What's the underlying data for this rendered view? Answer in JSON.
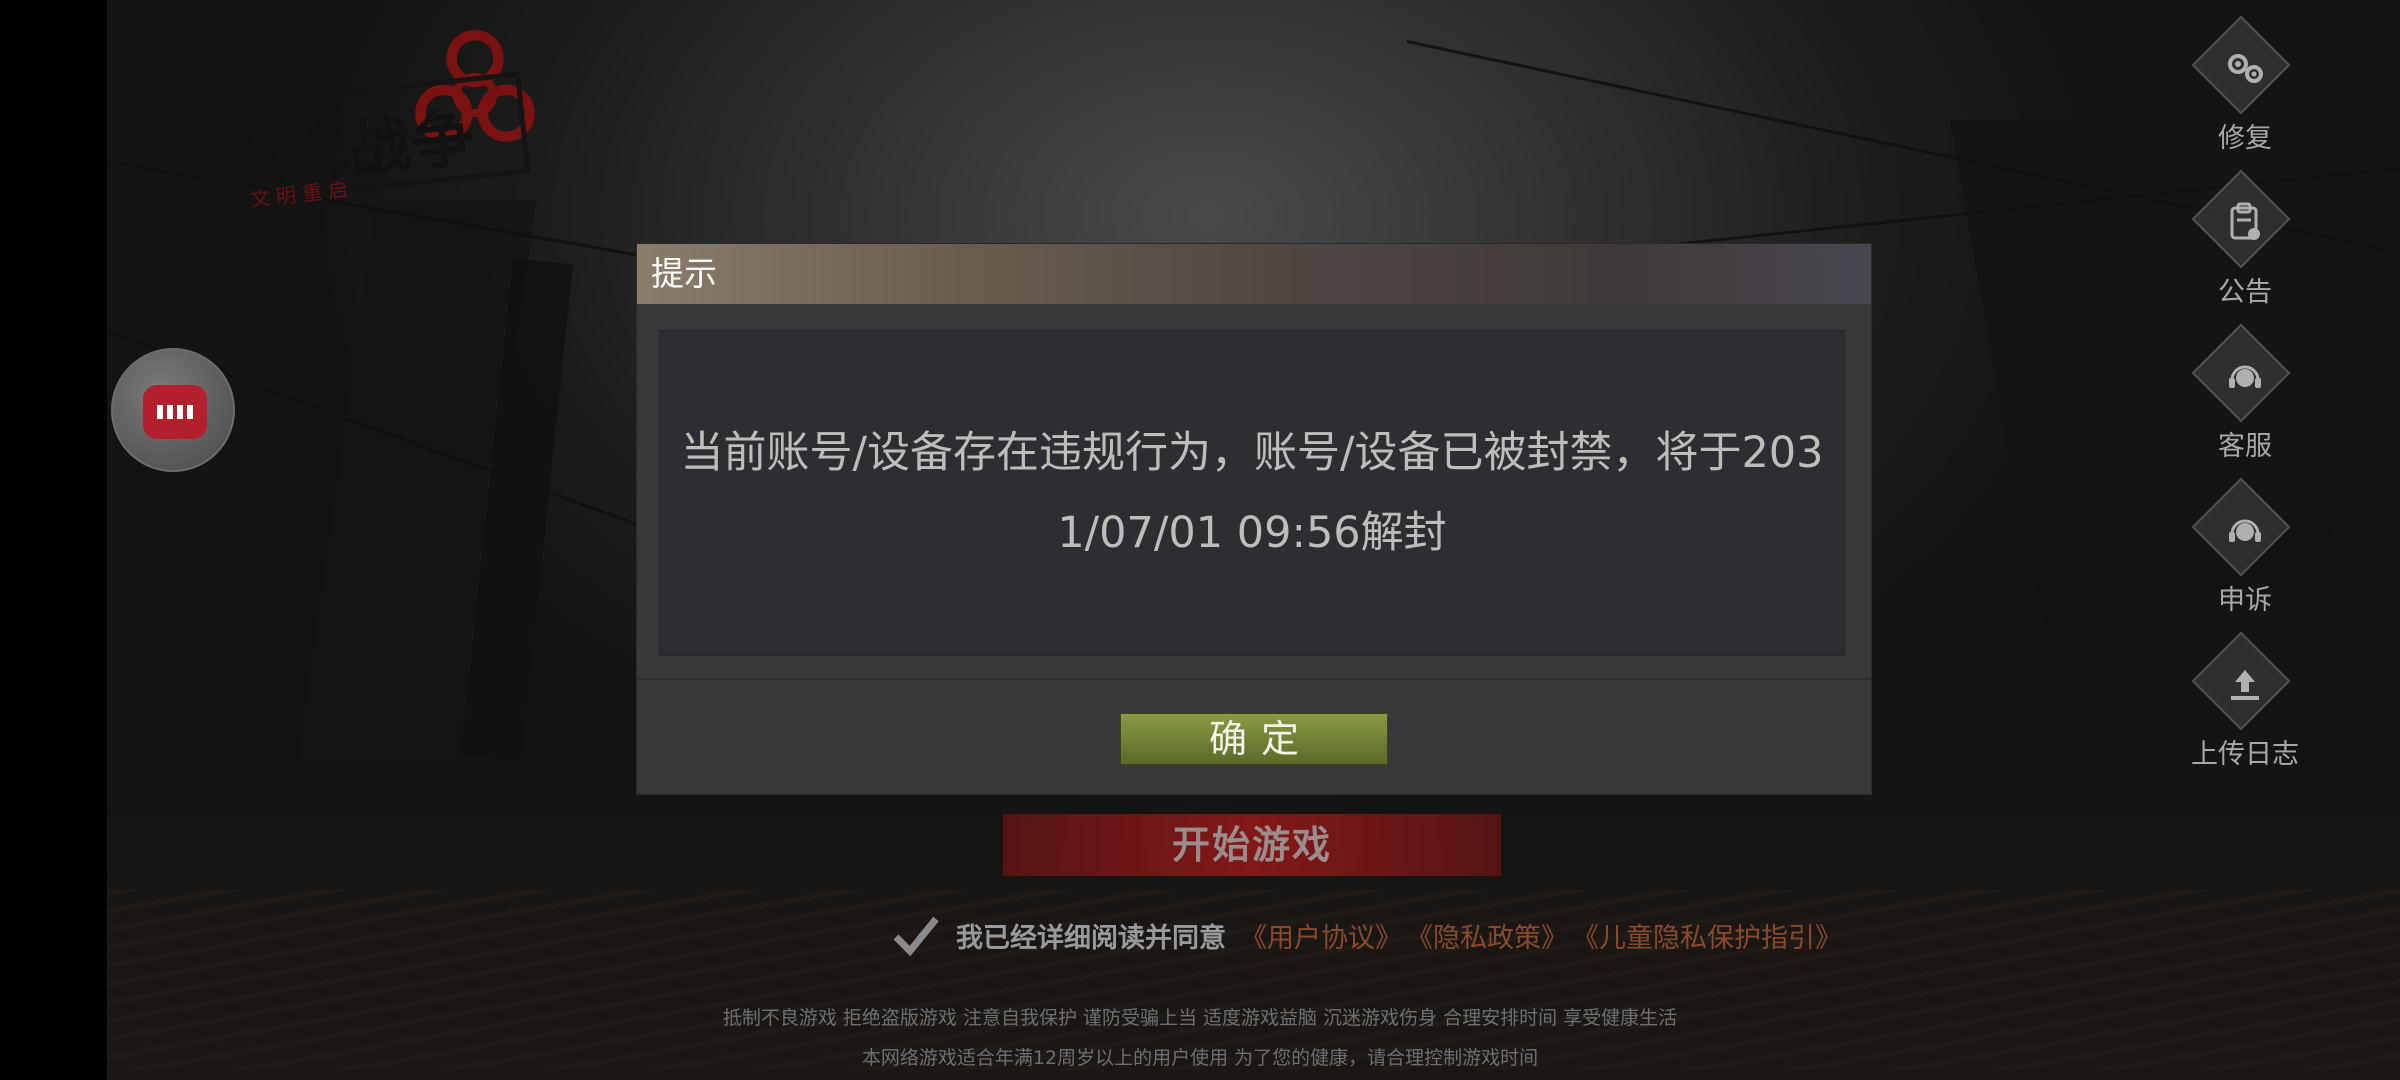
{
  "logo": {
    "title": "王牌战争",
    "subtitle": "文明重启"
  },
  "side_menu": [
    {
      "label": "修复",
      "icon": "gears-icon"
    },
    {
      "label": "公告",
      "icon": "clipboard-icon"
    },
    {
      "label": "客服",
      "icon": "headset-icon"
    },
    {
      "label": "申诉",
      "icon": "headset-icon"
    },
    {
      "label": "上传日志",
      "icon": "upload-icon"
    }
  ],
  "start_button": {
    "label": "开始游戏"
  },
  "agreement": {
    "text": "我已经详细阅读并同意",
    "links": [
      "《用户协议》",
      "《隐私政策》",
      "《儿童隐私保护指引》"
    ]
  },
  "notices": {
    "line1": "抵制不良游戏 拒绝盗版游戏 注意自我保护 谨防受骗上当 适度游戏益脑 沉迷游戏伤身 合理安排时间 享受健康生活",
    "line2": "本网络游戏适合年满12周岁以上的用户使用    为了您的健康，请合理控制游戏时间"
  },
  "dialog": {
    "title": "提示",
    "message": "当前账号/设备存在违规行为，账号/设备已被封禁，将于2031/07/01 09:56解封",
    "confirm_label": "确定"
  },
  "colors": {
    "confirm_button": "#6f7f33",
    "start_button": "#961919",
    "link": "#8a4a2a"
  }
}
